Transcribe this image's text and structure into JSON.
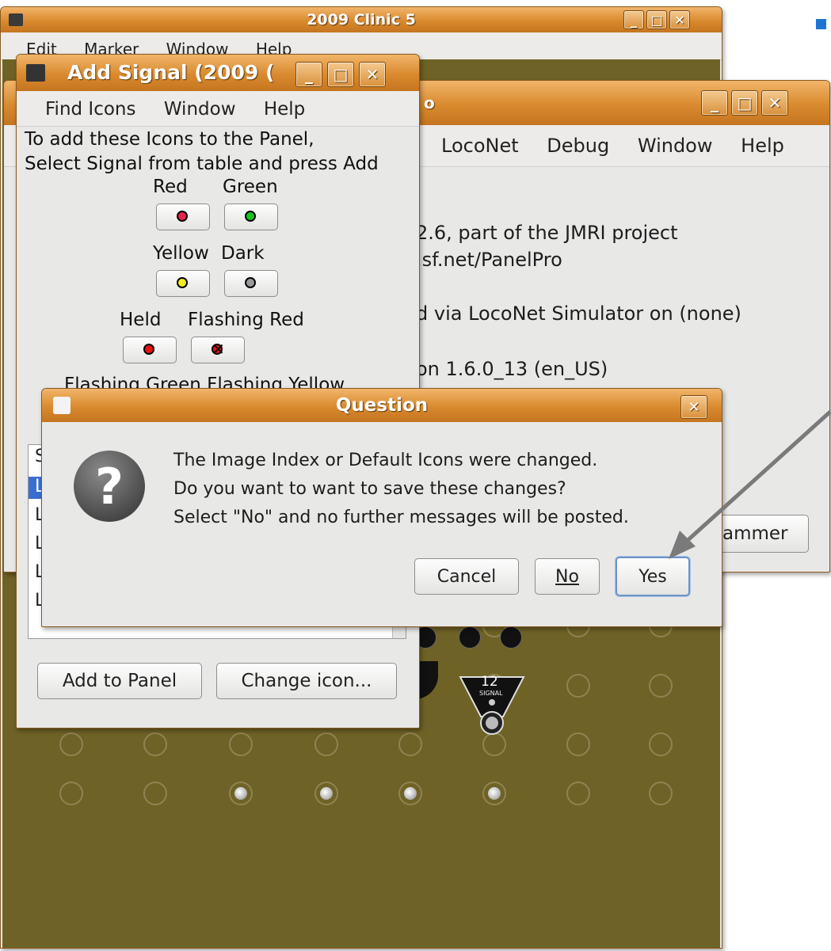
{
  "main_window": {
    "title": "2009 Clinic 5",
    "menu": [
      "Edit",
      "Marker",
      "Window",
      "Help"
    ]
  },
  "pro_window": {
    "title_fragment": "o",
    "menu": [
      "LocoNet",
      "Debug",
      "Window",
      "Help"
    ],
    "info_lines": [
      "2.6, part of the JMRI project",
      ".sf.net/PanelPro",
      "d via LocoNet Simulator on (none)",
      "on 1.6.0_13 (en_US)"
    ],
    "button_label": "ammer"
  },
  "add_signal_window": {
    "title": "Add Signal (2009 (",
    "menu": [
      "Find Icons",
      "Window",
      "Help"
    ],
    "instructions": [
      "To add these Icons to the Panel,",
      "Select Signal from table and press Add"
    ],
    "icon_rows": [
      {
        "labels": [
          "Red",
          "Green"
        ],
        "lamp_colors": [
          "#e8204a",
          "#12c81a"
        ]
      },
      {
        "labels": [
          "Yellow",
          "Dark"
        ],
        "lamp_colors": [
          "#f4ee14",
          "#9a9a9a"
        ]
      },
      {
        "labels": [
          "Held",
          "Flashing Red"
        ],
        "lamp_colors": [
          "#ee1111",
          "#ee1111"
        ]
      }
    ],
    "partial_label": "Flashing Green Flashing Yellow",
    "table_first_col_header": "S",
    "table_row_prefix": "L",
    "add_button": "Add to Panel",
    "change_button": "Change icon..."
  },
  "dialog": {
    "title": "Question",
    "lines": [
      "The Image Index or Default Icons were changed.",
      "Do you want to want to save these changes?",
      "Select \"No\" and no further messages will be posted."
    ],
    "cancel": "Cancel",
    "no": "No",
    "yes": "Yes"
  },
  "panel": {
    "signal_number": "12",
    "signal_text": "SIGNAL"
  },
  "colors": {
    "title_orange": "#d98a2e",
    "panel_olive": "#6f6226",
    "arrow_gray": "#7a7a7a",
    "marker_blue": "#1e74d6"
  }
}
